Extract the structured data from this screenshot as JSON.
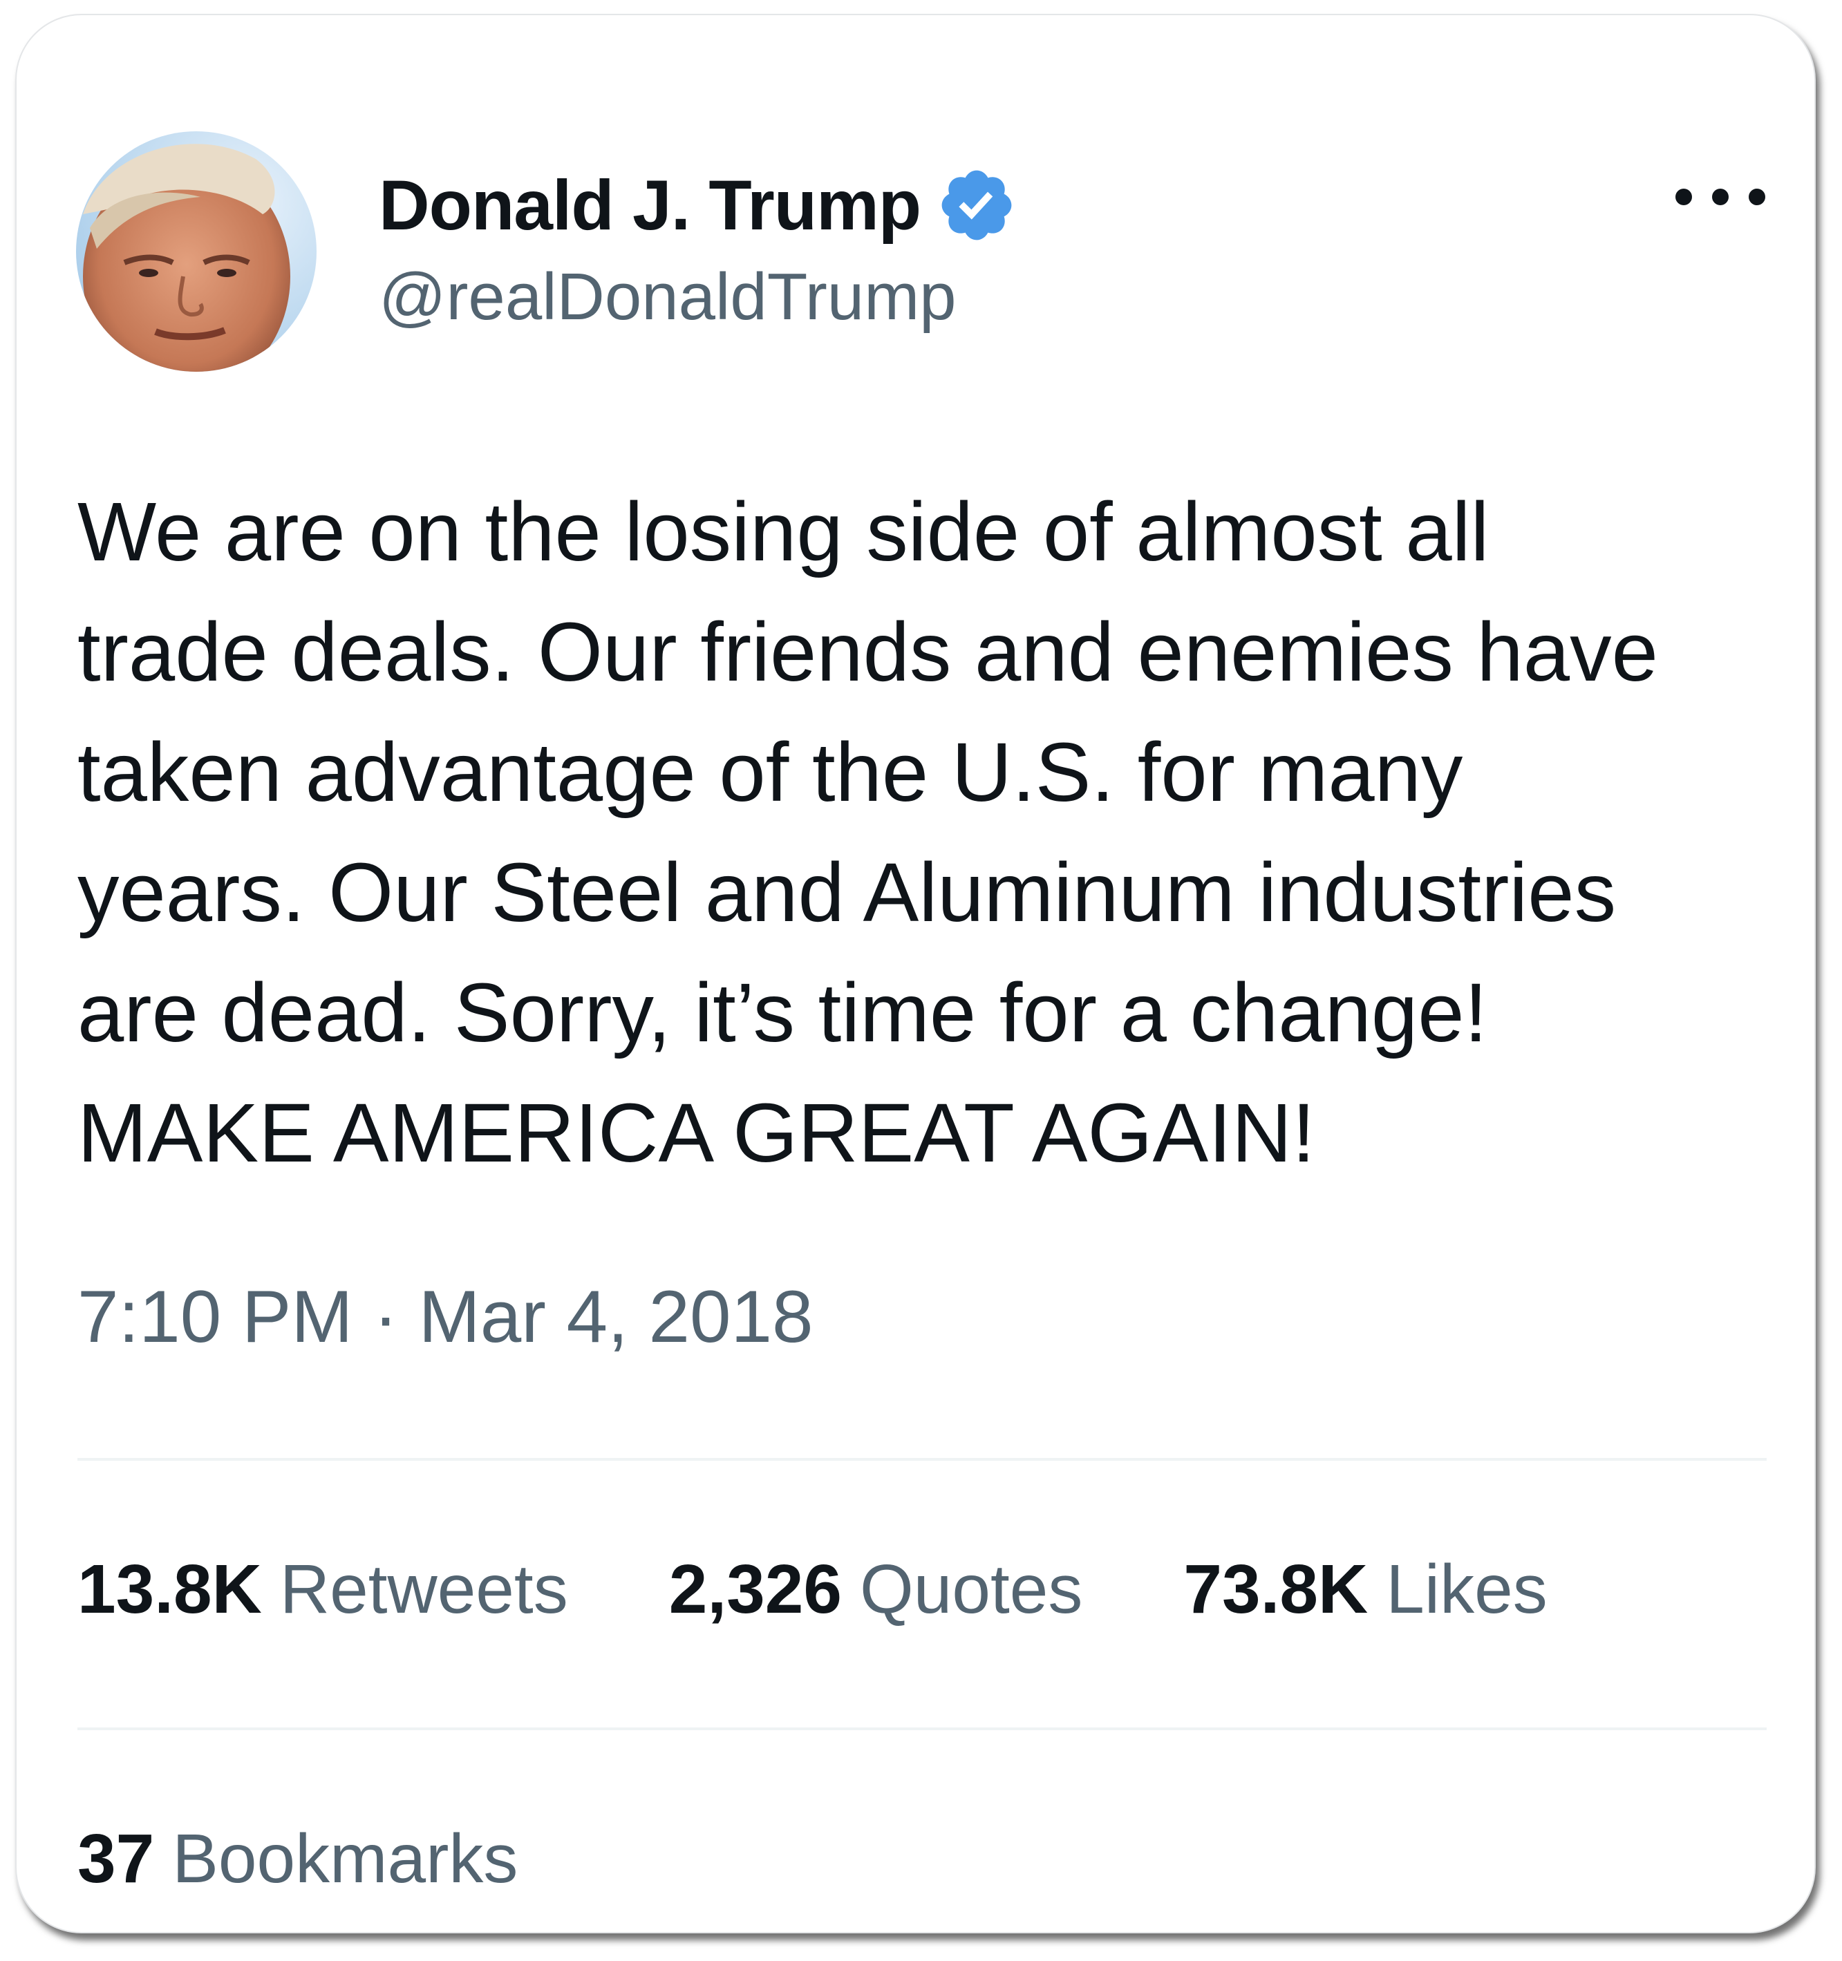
{
  "author": {
    "name": "Donald J. Trump",
    "handle": "@realDonaldTrump",
    "verified": true,
    "verified_color": "#4a99e9"
  },
  "icons": {
    "verified": "verified-badge-icon",
    "more": "more-options-icon"
  },
  "tweet": {
    "lines": [
      "We are on the losing side of almost all",
      "trade deals. Our friends and enemies have",
      "taken advantage of the U.S. for many",
      "years. Our Steel and Aluminum industries",
      "are dead. Sorry, it’s time for a change!",
      "MAKE AMERICA GREAT AGAIN!"
    ],
    "timestamp": "7:10 PM · Mar 4, 2018"
  },
  "stats": {
    "retweets": {
      "count": "13.8K",
      "label": "Retweets"
    },
    "quotes": {
      "count": "2,326",
      "label": "Quotes"
    },
    "likes": {
      "count": "73.8K",
      "label": "Likes"
    },
    "bookmarks": {
      "count": "37",
      "label": "Bookmarks"
    }
  },
  "colors": {
    "text_primary": "#0f1419",
    "text_secondary": "#536471",
    "divider": "#eff3f4"
  }
}
